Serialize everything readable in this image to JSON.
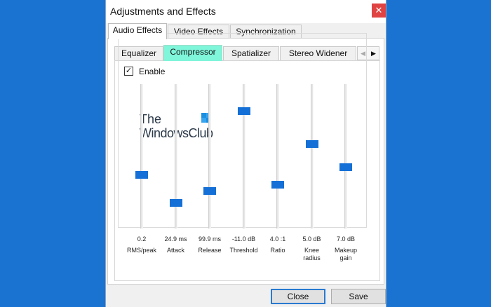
{
  "window": {
    "title": "Adjustments and Effects",
    "close_glyph": "✕"
  },
  "main_tabs": [
    {
      "label": "Audio Effects",
      "active": true
    },
    {
      "label": "Video Effects",
      "active": false
    },
    {
      "label": "Synchronization",
      "active": false
    }
  ],
  "sub_tabs": [
    {
      "label": "Equalizer",
      "active": false
    },
    {
      "label": "Compressor",
      "active": true
    },
    {
      "label": "Spatializer",
      "active": false
    },
    {
      "label": "Stereo Widener",
      "active": false
    }
  ],
  "scroll_buttons": {
    "left": "◀",
    "right": "▶"
  },
  "compressor": {
    "enable_label": "Enable",
    "enabled": true,
    "check_glyph": "✓",
    "sliders": [
      {
        "value": "0.2",
        "label": "RMS/peak",
        "level": 0.28
      },
      {
        "value": "24.9 ms",
        "label": "Attack",
        "level": 0.1
      },
      {
        "value": "99.9 ms",
        "label": "Release",
        "level": 0.18
      },
      {
        "value": "-11.0 dB",
        "label": "Threshold",
        "level": 0.69
      },
      {
        "value": "4.0 :1",
        "label": "Ratio",
        "level": 0.22
      },
      {
        "value": "5.0 dB",
        "label": "Knee radius",
        "level": 0.48
      },
      {
        "value": "7.0 dB",
        "label": "Makeup gain",
        "level": 0.33
      }
    ]
  },
  "watermark": {
    "line1": "The",
    "line2": "WindowsClub"
  },
  "buttons": {
    "close": "Close",
    "save": "Save"
  },
  "colors": {
    "accent": "#1470d6",
    "active_tab": "#7ff5da",
    "background": "#1a73d1"
  }
}
